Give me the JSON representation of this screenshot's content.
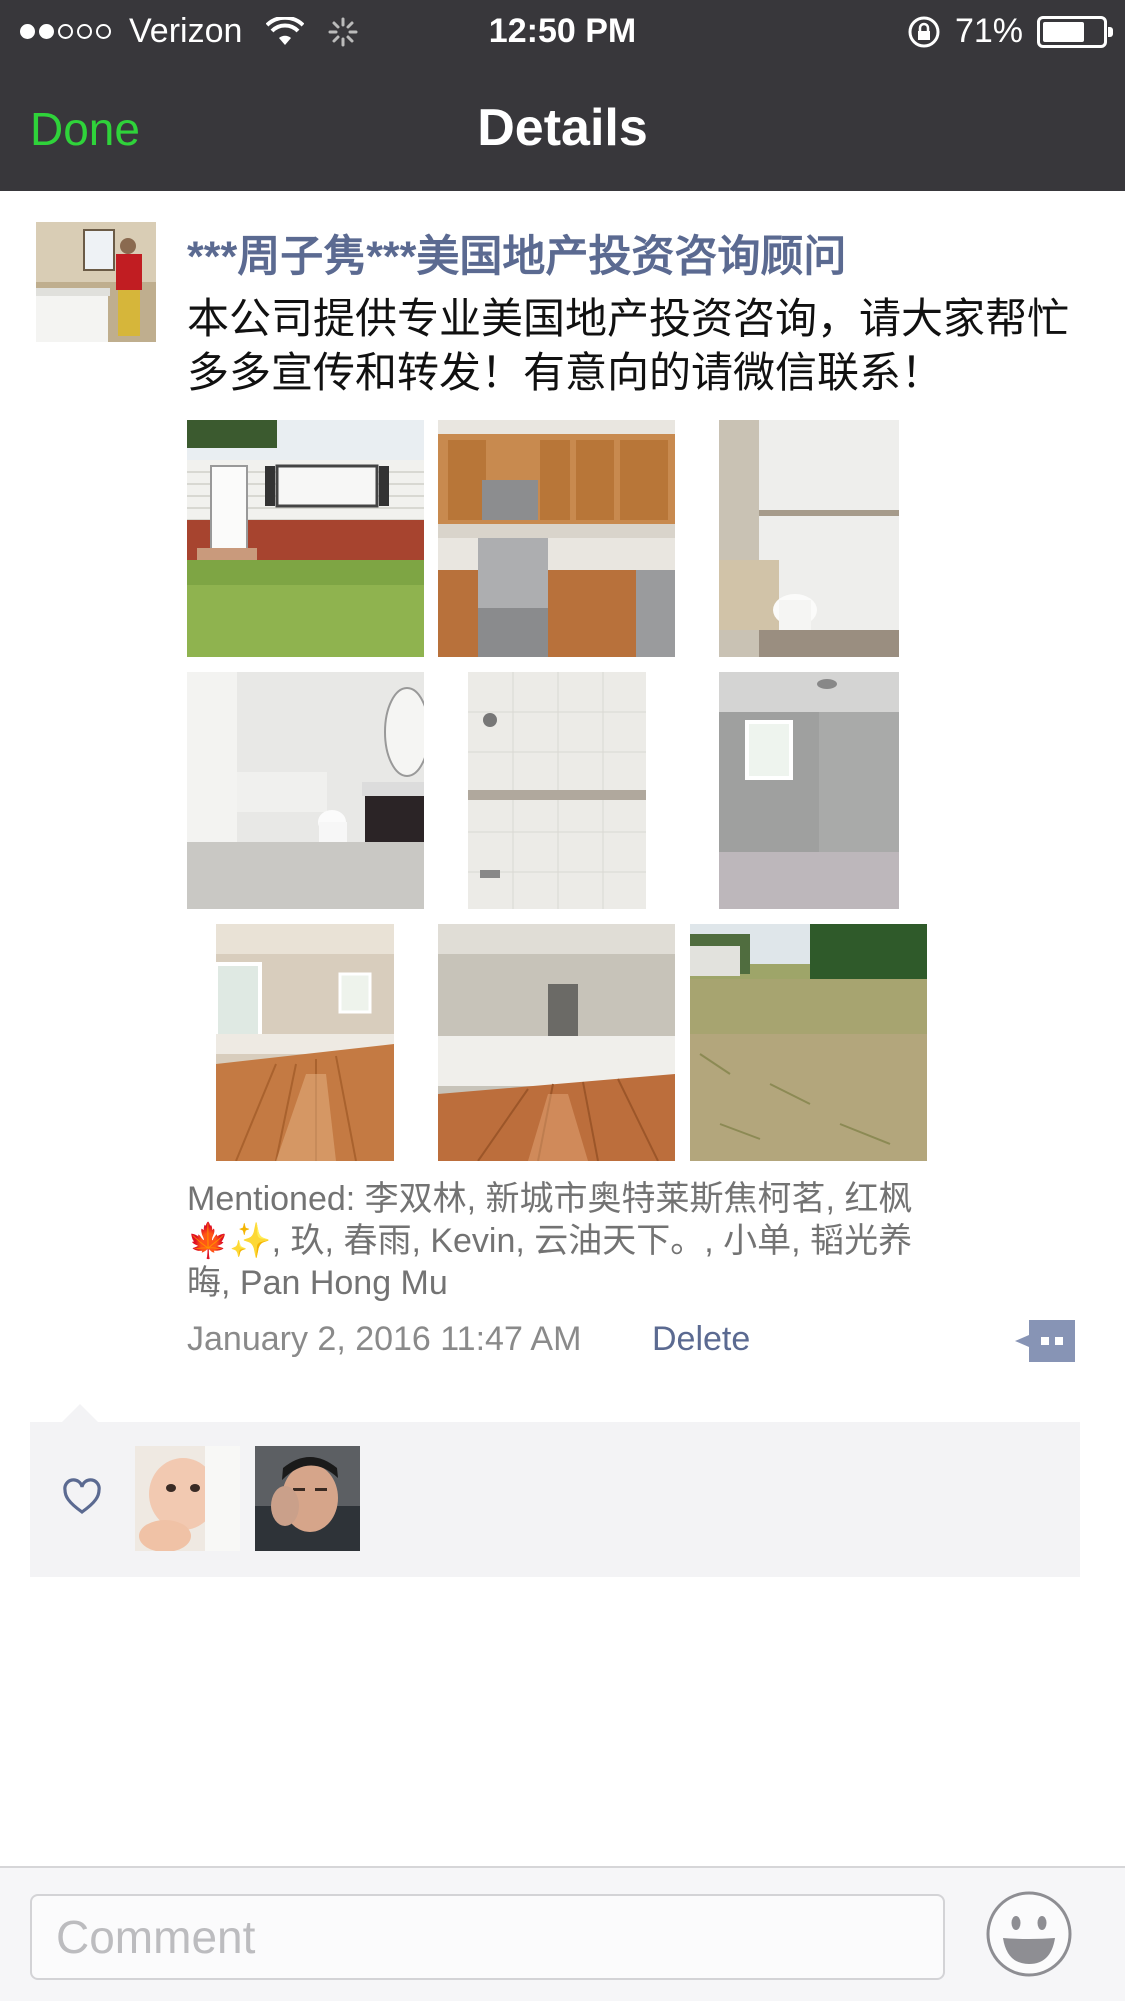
{
  "status_bar": {
    "carrier": "Verizon",
    "time": "12:50 PM",
    "battery": "71%",
    "battery_level": 0.71
  },
  "nav": {
    "done_label": "Done",
    "title": "Details"
  },
  "post": {
    "author": "***周子隽***美国地产投资咨询顾问",
    "text": "本公司提供专业美国地产投资咨询，请大家帮忙多多宣传和转发！有意向的请微信联系！",
    "photo_count": 9,
    "mentioned": "Mentioned: 李双林, 新城市奥特莱斯焦柯茗, 红枫🍁✨, 玖, 春雨, Kevin, 云油天下。, 小单, 韬光养晦, Pan Hong Mu",
    "timestamp": "January 2, 2016 11:47 AM",
    "delete_label": "Delete"
  },
  "likes": {
    "icon": "heart-icon",
    "count_shown": 2
  },
  "comment_bar": {
    "placeholder": "Comment",
    "emoji_icon": "smiley-icon"
  },
  "colors": {
    "nav_bg": "#38373b",
    "done_green": "#2fd33a",
    "link_blue": "#5b6a91",
    "panel_bg": "#f3f3f5"
  }
}
